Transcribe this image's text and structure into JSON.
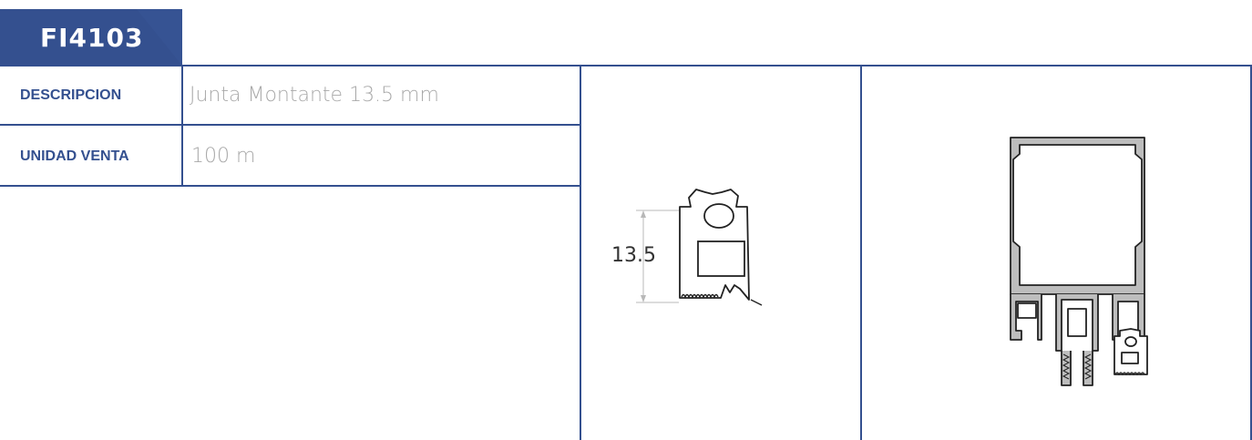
{
  "product": {
    "code": "FI4103"
  },
  "specs": [
    {
      "label": "DESCRIPCION",
      "value": "Junta Montante 13.5 mm"
    },
    {
      "label": "UNIDAD VENTA",
      "value": "100 m"
    }
  ],
  "drawing": {
    "dimension_label": "13.5"
  },
  "colors": {
    "accent": "#34508f",
    "value_text": "#a9a9a9"
  }
}
